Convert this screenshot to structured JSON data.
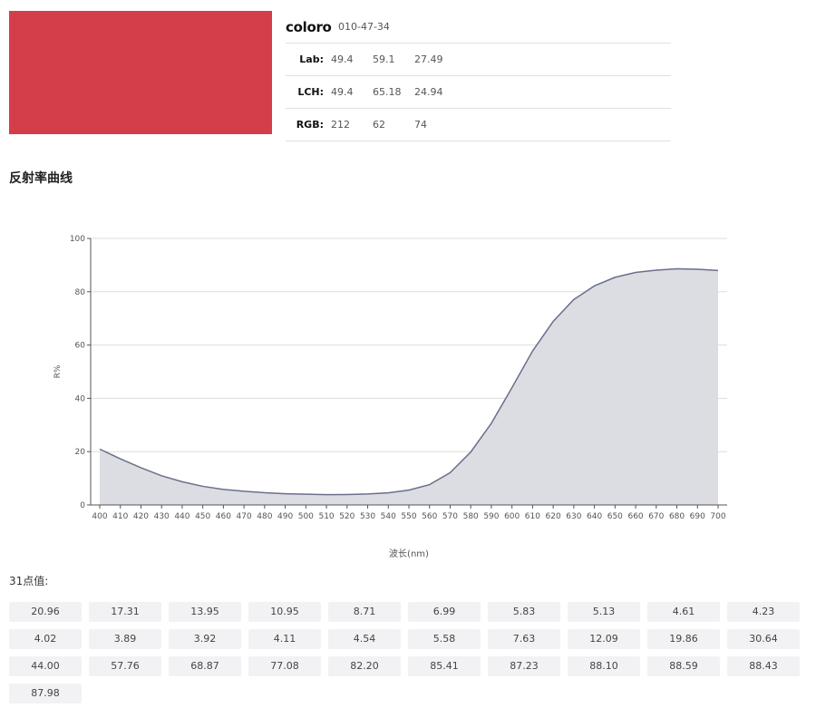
{
  "swatch": {
    "color": "#d43e4a"
  },
  "info": {
    "brand": "coloro",
    "code": "010-47-34",
    "rows": [
      {
        "label": "Lab:",
        "values": [
          "49.4",
          "59.1",
          "27.49"
        ]
      },
      {
        "label": "LCH:",
        "values": [
          "49.4",
          "65.18",
          "24.94"
        ]
      },
      {
        "label": "RGB:",
        "values": [
          "212",
          "62",
          "74"
        ]
      }
    ]
  },
  "section_title": "反射率曲线",
  "chart_data": {
    "type": "area",
    "xlabel": "波长(nm)",
    "ylabel": "R%",
    "ylim": [
      0,
      100
    ],
    "yticks": [
      0,
      20,
      40,
      60,
      80,
      100
    ],
    "x": [
      400,
      410,
      420,
      430,
      440,
      450,
      460,
      470,
      480,
      490,
      500,
      510,
      520,
      530,
      540,
      550,
      560,
      570,
      580,
      590,
      600,
      610,
      620,
      630,
      640,
      650,
      660,
      670,
      680,
      690,
      700
    ],
    "values": [
      20.96,
      17.31,
      13.95,
      10.95,
      8.71,
      6.99,
      5.83,
      5.13,
      4.61,
      4.23,
      4.02,
      3.89,
      3.92,
      4.11,
      4.54,
      5.58,
      7.63,
      12.09,
      19.86,
      30.64,
      44.0,
      57.76,
      68.87,
      77.08,
      82.2,
      85.41,
      87.23,
      88.1,
      88.59,
      88.43,
      87.98
    ],
    "grid": true,
    "line_color": "#6b6f8a",
    "fill_color": "#dcdde3"
  },
  "points_title": "31点值:",
  "points": [
    "20.96",
    "17.31",
    "13.95",
    "10.95",
    "8.71",
    "6.99",
    "5.83",
    "5.13",
    "4.61",
    "4.23",
    "4.02",
    "3.89",
    "3.92",
    "4.11",
    "4.54",
    "5.58",
    "7.63",
    "12.09",
    "19.86",
    "30.64",
    "44.00",
    "57.76",
    "68.87",
    "77.08",
    "82.20",
    "85.41",
    "87.23",
    "88.10",
    "88.59",
    "88.43",
    "87.98"
  ]
}
